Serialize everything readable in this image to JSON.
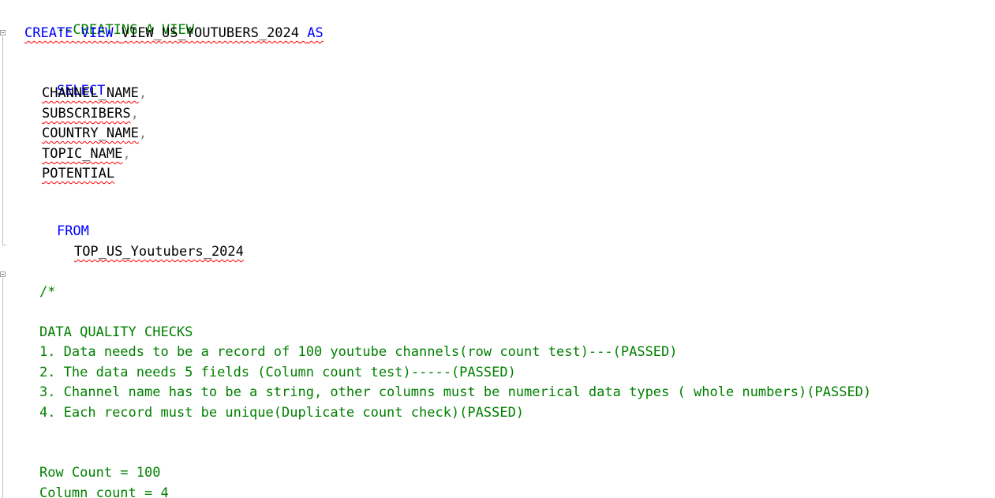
{
  "editor": {
    "comment_view": "--CREATING A VIEW",
    "create_kw": "CREATE VIEW",
    "view_name": "VIEW_US_YOUTUBERS_2024",
    "as_kw": "AS",
    "select_kw": "SELECT",
    "columns": [
      {
        "name": "CHANNEL_NAME",
        "sep": ","
      },
      {
        "name": "SUBSCRIBERS",
        "sep": ","
      },
      {
        "name": "COUNTRY_NAME",
        "sep": ","
      },
      {
        "name": "TOPIC_NAME",
        "sep": ","
      },
      {
        "name": "POTENTIAL",
        "sep": ""
      }
    ],
    "from_kw": "FROM",
    "table_name": "TOP_US_Youtubers_2024",
    "block_comment_open": "/*",
    "dq_title": "DATA QUALITY CHECKS",
    "checks": [
      "1. Data needs to be a record of 100 youtube channels(row count test)---(PASSED)",
      "2. The data needs 5 fields (Column count test)-----(PASSED)",
      "3. Channel name has to be a string, other columns must be numerical data types ( whole numbers)(PASSED)",
      "4. Each record must be unique(Duplicate count check)(PASSED)"
    ],
    "row_count": "Row Count = 100",
    "column_count": "Column count = 4"
  }
}
